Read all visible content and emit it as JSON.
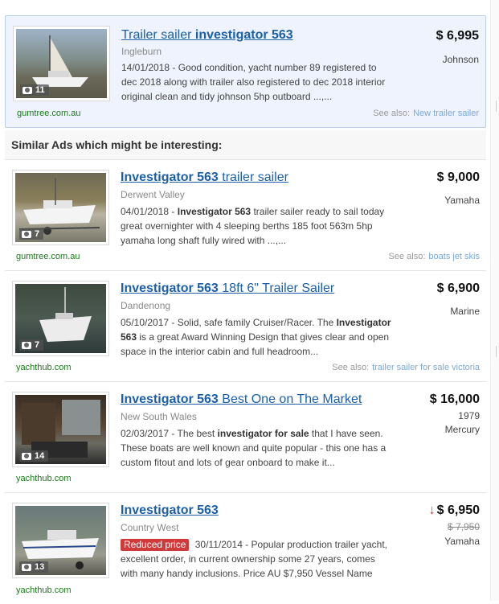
{
  "featured": {
    "title_plain": "Trailer sailer ",
    "title_bold": "investigator 563",
    "location": "Ingleburn",
    "description": "14/01/2018 - Good condition, yacht number 89 registered to dec 2018 along with trailer also registered to dec 2018 interior original clean and tidy johnson 5hp outboard ...,...",
    "price": "$ 6,995",
    "meta": "Johnson",
    "photo_count": "11",
    "source": "gumtree.com.au",
    "see_also_label": "See also:",
    "see_also_link": "New trailer sailer"
  },
  "section_header": "Similar Ads which might be interesting:",
  "listings": [
    {
      "title_bold": "Investigator 563",
      "title_plain": " trailer sailer",
      "location": "Derwent Valley",
      "desc_date": "04/01/2018 - ",
      "desc_bold": "Investigator 563",
      "desc_rest": " trailer sailer ready to sail today great overnighter with 4 sleeping berths 185 foot 563m 5hp yamaha long shaft fully wired with ...,...",
      "price": "$ 9,000",
      "meta1": "Yamaha",
      "meta2": "",
      "photo_count": "7",
      "source": "gumtree.com.au",
      "see_also_label": "See also:",
      "see_also_link": "boats jet skis"
    },
    {
      "title_bold": "Investigator 563",
      "title_plain": " 18ft 6\" Trailer Sailer",
      "location": "Dandenong",
      "desc_date": "05/10/2017 - Solid, safe family Cruiser/Racer. The ",
      "desc_bold": "Investigator 563",
      "desc_rest": " is a great Award Winning Design that gives clear and open space in the interior cabin and full headroom...",
      "price": "$ 6,900",
      "meta1": "Marine",
      "meta2": "",
      "photo_count": "7",
      "source": "yachthub.com",
      "see_also_label": "See also:",
      "see_also_link": "trailer sailer for sale victoria"
    },
    {
      "title_bold": "Investigator 563",
      "title_plain": " Best One on The Market",
      "location": "New South Wales",
      "desc_date": "02/03/2017 - The best ",
      "desc_bold": "investigator for sale",
      "desc_rest": " that I have seen. These boats are well known and quite popular - this one has a custom fitout and lots of gear onboard to make it...",
      "price": "$ 16,000",
      "meta1": "1979",
      "meta2": "Mercury",
      "photo_count": "14",
      "source": "yachthub.com",
      "see_also_label": "",
      "see_also_link": ""
    },
    {
      "title_bold": "Investigator 563",
      "title_plain": "",
      "location": "Country West",
      "badge": "Reduced price",
      "desc_date": " 30/11/2014 - Popular production trailer yacht, excellent order, in current ownership some 27 years, comes with many handy inclusions. Price AU $7,950 Vessel Name",
      "desc_bold": "",
      "desc_rest": "",
      "price": "$ 6,950",
      "old_price": "$ 7,950",
      "meta1": "Yamaha",
      "meta2": "",
      "photo_count": "13",
      "source": "yachthub.com",
      "see_also_label": "",
      "see_also_link": ""
    }
  ]
}
